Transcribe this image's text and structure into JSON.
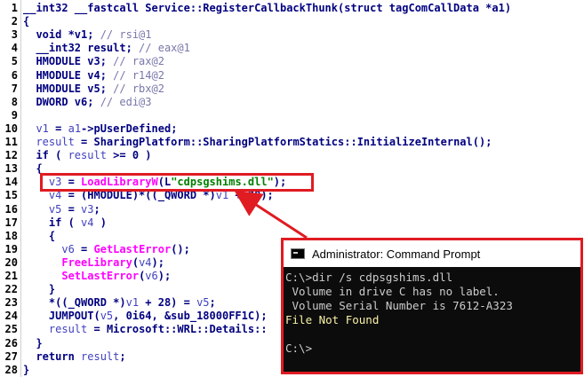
{
  "code": {
    "lines": [
      {
        "n": "1",
        "segs": [
          {
            "c": "plain",
            "t": "__int32 __fastcall Service::RegisterCallbackThunk(struct tagComCallData *a1)"
          }
        ]
      },
      {
        "n": "2",
        "segs": [
          {
            "c": "plain",
            "t": "{"
          }
        ]
      },
      {
        "n": "3",
        "segs": [
          {
            "c": "plain",
            "t": "  void *v1; "
          },
          {
            "c": "comment",
            "t": "// rsi@1"
          }
        ]
      },
      {
        "n": "4",
        "segs": [
          {
            "c": "plain",
            "t": "  __int32 result; "
          },
          {
            "c": "comment",
            "t": "// eax@1"
          }
        ]
      },
      {
        "n": "5",
        "segs": [
          {
            "c": "plain",
            "t": "  HMODULE v3; "
          },
          {
            "c": "comment",
            "t": "// rax@2"
          }
        ]
      },
      {
        "n": "6",
        "segs": [
          {
            "c": "plain",
            "t": "  HMODULE v4; "
          },
          {
            "c": "comment",
            "t": "// r14@2"
          }
        ]
      },
      {
        "n": "7",
        "segs": [
          {
            "c": "plain",
            "t": "  HMODULE v5; "
          },
          {
            "c": "comment",
            "t": "// rbx@2"
          }
        ]
      },
      {
        "n": "8",
        "segs": [
          {
            "c": "plain",
            "t": "  DWORD v6; "
          },
          {
            "c": "comment",
            "t": "// edi@3"
          }
        ]
      },
      {
        "n": "9",
        "segs": [
          {
            "c": "plain",
            "t": ""
          }
        ]
      },
      {
        "n": "10",
        "segs": [
          {
            "c": "plain",
            "t": "  "
          },
          {
            "c": "var",
            "t": "v1"
          },
          {
            "c": "plain",
            "t": " = "
          },
          {
            "c": "var",
            "t": "a1"
          },
          {
            "c": "plain",
            "t": "->pUserDefined;"
          }
        ]
      },
      {
        "n": "11",
        "segs": [
          {
            "c": "plain",
            "t": "  "
          },
          {
            "c": "var",
            "t": "result"
          },
          {
            "c": "plain",
            "t": " = SharingPlatform::SharingPlatformStatics::InitializeInternal();"
          }
        ]
      },
      {
        "n": "12",
        "segs": [
          {
            "c": "plain",
            "t": "  if ( "
          },
          {
            "c": "var",
            "t": "result"
          },
          {
            "c": "plain",
            "t": " >= 0 )"
          }
        ]
      },
      {
        "n": "13",
        "segs": [
          {
            "c": "plain",
            "t": "  {"
          }
        ]
      },
      {
        "n": "14",
        "segs": [
          {
            "c": "plain",
            "t": "    "
          },
          {
            "c": "var",
            "t": "v3"
          },
          {
            "c": "plain",
            "t": " = "
          },
          {
            "c": "func",
            "t": "LoadLibraryW"
          },
          {
            "c": "plain",
            "t": "(L"
          },
          {
            "c": "str",
            "t": "\"cdpsgshims.dll\""
          },
          {
            "c": "plain",
            "t": ");"
          }
        ]
      },
      {
        "n": "15",
        "segs": [
          {
            "c": "plain",
            "t": "    "
          },
          {
            "c": "var",
            "t": "v4"
          },
          {
            "c": "plain",
            "t": " = (HMODULE)*((_QWORD *)"
          },
          {
            "c": "var",
            "t": "v1"
          },
          {
            "c": "plain",
            "t": " + 28);"
          }
        ]
      },
      {
        "n": "16",
        "segs": [
          {
            "c": "plain",
            "t": "    "
          },
          {
            "c": "var",
            "t": "v5"
          },
          {
            "c": "plain",
            "t": " = "
          },
          {
            "c": "var",
            "t": "v3"
          },
          {
            "c": "plain",
            "t": ";"
          }
        ]
      },
      {
        "n": "17",
        "segs": [
          {
            "c": "plain",
            "t": "    if ( "
          },
          {
            "c": "var",
            "t": "v4"
          },
          {
            "c": "plain",
            "t": " )"
          }
        ]
      },
      {
        "n": "18",
        "segs": [
          {
            "c": "plain",
            "t": "    {"
          }
        ]
      },
      {
        "n": "19",
        "segs": [
          {
            "c": "plain",
            "t": "      "
          },
          {
            "c": "var",
            "t": "v6"
          },
          {
            "c": "plain",
            "t": " = "
          },
          {
            "c": "func",
            "t": "GetLastError"
          },
          {
            "c": "plain",
            "t": "();"
          }
        ]
      },
      {
        "n": "20",
        "segs": [
          {
            "c": "plain",
            "t": "      "
          },
          {
            "c": "func",
            "t": "FreeLibrary"
          },
          {
            "c": "plain",
            "t": "("
          },
          {
            "c": "var",
            "t": "v4"
          },
          {
            "c": "plain",
            "t": ");"
          }
        ]
      },
      {
        "n": "21",
        "segs": [
          {
            "c": "plain",
            "t": "      "
          },
          {
            "c": "func",
            "t": "SetLastError"
          },
          {
            "c": "plain",
            "t": "("
          },
          {
            "c": "var",
            "t": "v6"
          },
          {
            "c": "plain",
            "t": ");"
          }
        ]
      },
      {
        "n": "22",
        "segs": [
          {
            "c": "plain",
            "t": "    }"
          }
        ]
      },
      {
        "n": "23",
        "segs": [
          {
            "c": "plain",
            "t": "    *((_QWORD *)"
          },
          {
            "c": "var",
            "t": "v1"
          },
          {
            "c": "plain",
            "t": " + 28) = "
          },
          {
            "c": "var",
            "t": "v5"
          },
          {
            "c": "plain",
            "t": ";"
          }
        ]
      },
      {
        "n": "24",
        "segs": [
          {
            "c": "plain",
            "t": "    JUMPOUT("
          },
          {
            "c": "var",
            "t": "v5"
          },
          {
            "c": "plain",
            "t": ", 0i64, &sub_18000FF1C);"
          }
        ]
      },
      {
        "n": "25",
        "segs": [
          {
            "c": "plain",
            "t": "    "
          },
          {
            "c": "var",
            "t": "result"
          },
          {
            "c": "plain",
            "t": " = Microsoft::WRL::Details::"
          }
        ]
      },
      {
        "n": "26",
        "segs": [
          {
            "c": "plain",
            "t": "  }"
          }
        ]
      },
      {
        "n": "27",
        "segs": [
          {
            "c": "plain",
            "t": "  return "
          },
          {
            "c": "var",
            "t": "result"
          },
          {
            "c": "plain",
            "t": ";"
          }
        ]
      },
      {
        "n": "28",
        "segs": [
          {
            "c": "plain",
            "t": "}"
          }
        ]
      }
    ]
  },
  "cmd": {
    "title": "Administrator: Command Prompt",
    "lines": [
      {
        "t": "C:\\>dir /s cdpsgshims.dll",
        "c": "normal"
      },
      {
        "t": " Volume in drive C has no label.",
        "c": "normal"
      },
      {
        "t": " Volume Serial Number is 7612-A323",
        "c": "normal"
      },
      {
        "t": "File Not Found",
        "c": "yellow"
      },
      {
        "t": "",
        "c": "normal"
      },
      {
        "t": "C:\\>",
        "c": "normal"
      }
    ]
  },
  "colors": {
    "annotation_red": "#e01b22",
    "cmd_background": "#0c0c0c",
    "cmd_text": "#cccccc",
    "cmd_warning": "#f9f1a5"
  }
}
